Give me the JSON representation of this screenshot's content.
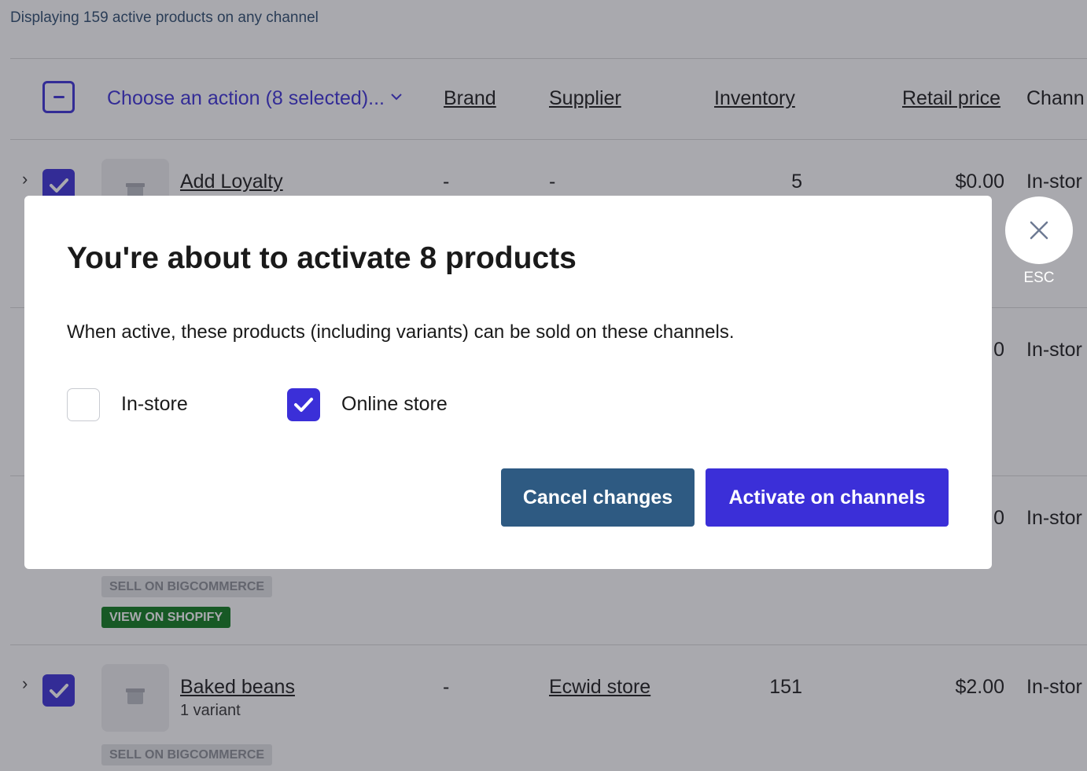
{
  "summary": "Displaying 159 active products on any channel",
  "table": {
    "action_menu": "Choose an action (8 selected)...",
    "columns": [
      "Brand",
      "Supplier",
      "Inventory",
      "Retail price",
      "Chann"
    ]
  },
  "rows": [
    {
      "name": "Add Loyalty",
      "variant": "",
      "brand": "-",
      "supplier": "-",
      "inventory": "5",
      "price": "$0.00",
      "channel": "In-stor"
    },
    {
      "price": "0",
      "channel": "In-stor"
    },
    {
      "price": "0",
      "channel": "In-stor",
      "tags": [
        "SELL ON BIGCOMMERCE",
        "VIEW ON SHOPIFY"
      ]
    },
    {
      "name": "Baked beans",
      "variant": "1 variant",
      "brand": "-",
      "supplier": "Ecwid store",
      "inventory": "151",
      "price": "$2.00",
      "channel": "In-stor",
      "tags": [
        "SELL ON BIGCOMMERCE"
      ]
    }
  ],
  "modal": {
    "title": "You're about to activate 8 products",
    "description": "When active, these products (including variants) can be sold on these channels.",
    "options": [
      {
        "label": "In-store",
        "checked": false
      },
      {
        "label": "Online store",
        "checked": true
      }
    ],
    "cancel_label": "Cancel changes",
    "activate_label": "Activate on channels"
  },
  "close": {
    "esc_label": "ESC"
  },
  "colors": {
    "accent": "#3b2fd8",
    "cancel": "#2e5a82",
    "shopify_tag": "#0c7a1c"
  },
  "icons": [
    "minus-icon",
    "chevron-down-icon",
    "chevron-right-icon",
    "check-icon",
    "box-icon",
    "close-icon"
  ]
}
